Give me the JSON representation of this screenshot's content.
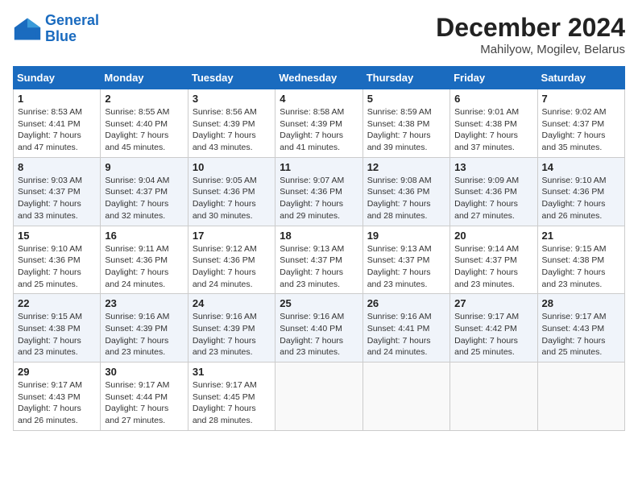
{
  "header": {
    "logo_line1": "General",
    "logo_line2": "Blue",
    "month_year": "December 2024",
    "location": "Mahilyow, Mogilev, Belarus"
  },
  "weekdays": [
    "Sunday",
    "Monday",
    "Tuesday",
    "Wednesday",
    "Thursday",
    "Friday",
    "Saturday"
  ],
  "weeks": [
    [
      {
        "day": "1",
        "info": "Sunrise: 8:53 AM\nSunset: 4:41 PM\nDaylight: 7 hours\nand 47 minutes."
      },
      {
        "day": "2",
        "info": "Sunrise: 8:55 AM\nSunset: 4:40 PM\nDaylight: 7 hours\nand 45 minutes."
      },
      {
        "day": "3",
        "info": "Sunrise: 8:56 AM\nSunset: 4:39 PM\nDaylight: 7 hours\nand 43 minutes."
      },
      {
        "day": "4",
        "info": "Sunrise: 8:58 AM\nSunset: 4:39 PM\nDaylight: 7 hours\nand 41 minutes."
      },
      {
        "day": "5",
        "info": "Sunrise: 8:59 AM\nSunset: 4:38 PM\nDaylight: 7 hours\nand 39 minutes."
      },
      {
        "day": "6",
        "info": "Sunrise: 9:01 AM\nSunset: 4:38 PM\nDaylight: 7 hours\nand 37 minutes."
      },
      {
        "day": "7",
        "info": "Sunrise: 9:02 AM\nSunset: 4:37 PM\nDaylight: 7 hours\nand 35 minutes."
      }
    ],
    [
      {
        "day": "8",
        "info": "Sunrise: 9:03 AM\nSunset: 4:37 PM\nDaylight: 7 hours\nand 33 minutes."
      },
      {
        "day": "9",
        "info": "Sunrise: 9:04 AM\nSunset: 4:37 PM\nDaylight: 7 hours\nand 32 minutes."
      },
      {
        "day": "10",
        "info": "Sunrise: 9:05 AM\nSunset: 4:36 PM\nDaylight: 7 hours\nand 30 minutes."
      },
      {
        "day": "11",
        "info": "Sunrise: 9:07 AM\nSunset: 4:36 PM\nDaylight: 7 hours\nand 29 minutes."
      },
      {
        "day": "12",
        "info": "Sunrise: 9:08 AM\nSunset: 4:36 PM\nDaylight: 7 hours\nand 28 minutes."
      },
      {
        "day": "13",
        "info": "Sunrise: 9:09 AM\nSunset: 4:36 PM\nDaylight: 7 hours\nand 27 minutes."
      },
      {
        "day": "14",
        "info": "Sunrise: 9:10 AM\nSunset: 4:36 PM\nDaylight: 7 hours\nand 26 minutes."
      }
    ],
    [
      {
        "day": "15",
        "info": "Sunrise: 9:10 AM\nSunset: 4:36 PM\nDaylight: 7 hours\nand 25 minutes."
      },
      {
        "day": "16",
        "info": "Sunrise: 9:11 AM\nSunset: 4:36 PM\nDaylight: 7 hours\nand 24 minutes."
      },
      {
        "day": "17",
        "info": "Sunrise: 9:12 AM\nSunset: 4:36 PM\nDaylight: 7 hours\nand 24 minutes."
      },
      {
        "day": "18",
        "info": "Sunrise: 9:13 AM\nSunset: 4:37 PM\nDaylight: 7 hours\nand 23 minutes."
      },
      {
        "day": "19",
        "info": "Sunrise: 9:13 AM\nSunset: 4:37 PM\nDaylight: 7 hours\nand 23 minutes."
      },
      {
        "day": "20",
        "info": "Sunrise: 9:14 AM\nSunset: 4:37 PM\nDaylight: 7 hours\nand 23 minutes."
      },
      {
        "day": "21",
        "info": "Sunrise: 9:15 AM\nSunset: 4:38 PM\nDaylight: 7 hours\nand 23 minutes."
      }
    ],
    [
      {
        "day": "22",
        "info": "Sunrise: 9:15 AM\nSunset: 4:38 PM\nDaylight: 7 hours\nand 23 minutes."
      },
      {
        "day": "23",
        "info": "Sunrise: 9:16 AM\nSunset: 4:39 PM\nDaylight: 7 hours\nand 23 minutes."
      },
      {
        "day": "24",
        "info": "Sunrise: 9:16 AM\nSunset: 4:39 PM\nDaylight: 7 hours\nand 23 minutes."
      },
      {
        "day": "25",
        "info": "Sunrise: 9:16 AM\nSunset: 4:40 PM\nDaylight: 7 hours\nand 23 minutes."
      },
      {
        "day": "26",
        "info": "Sunrise: 9:16 AM\nSunset: 4:41 PM\nDaylight: 7 hours\nand 24 minutes."
      },
      {
        "day": "27",
        "info": "Sunrise: 9:17 AM\nSunset: 4:42 PM\nDaylight: 7 hours\nand 25 minutes."
      },
      {
        "day": "28",
        "info": "Sunrise: 9:17 AM\nSunset: 4:43 PM\nDaylight: 7 hours\nand 25 minutes."
      }
    ],
    [
      {
        "day": "29",
        "info": "Sunrise: 9:17 AM\nSunset: 4:43 PM\nDaylight: 7 hours\nand 26 minutes."
      },
      {
        "day": "30",
        "info": "Sunrise: 9:17 AM\nSunset: 4:44 PM\nDaylight: 7 hours\nand 27 minutes."
      },
      {
        "day": "31",
        "info": "Sunrise: 9:17 AM\nSunset: 4:45 PM\nDaylight: 7 hours\nand 28 minutes."
      },
      null,
      null,
      null,
      null
    ]
  ]
}
